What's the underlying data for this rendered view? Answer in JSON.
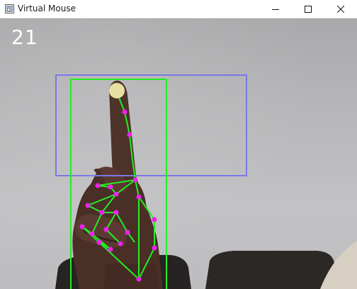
{
  "window": {
    "title": "Virtual Mouse",
    "buttons": {
      "minimize_icon": "minimize-icon",
      "maximize_icon": "maximize-icon",
      "close_icon": "close-icon"
    }
  },
  "overlay": {
    "fps": "21",
    "colors": {
      "active_region": "#7b78e6",
      "hand_box": "#22ee22",
      "landmark": "#ee22ee",
      "connection": "#22ee22",
      "fingertip_cursor": "#e6e0a2"
    }
  }
}
